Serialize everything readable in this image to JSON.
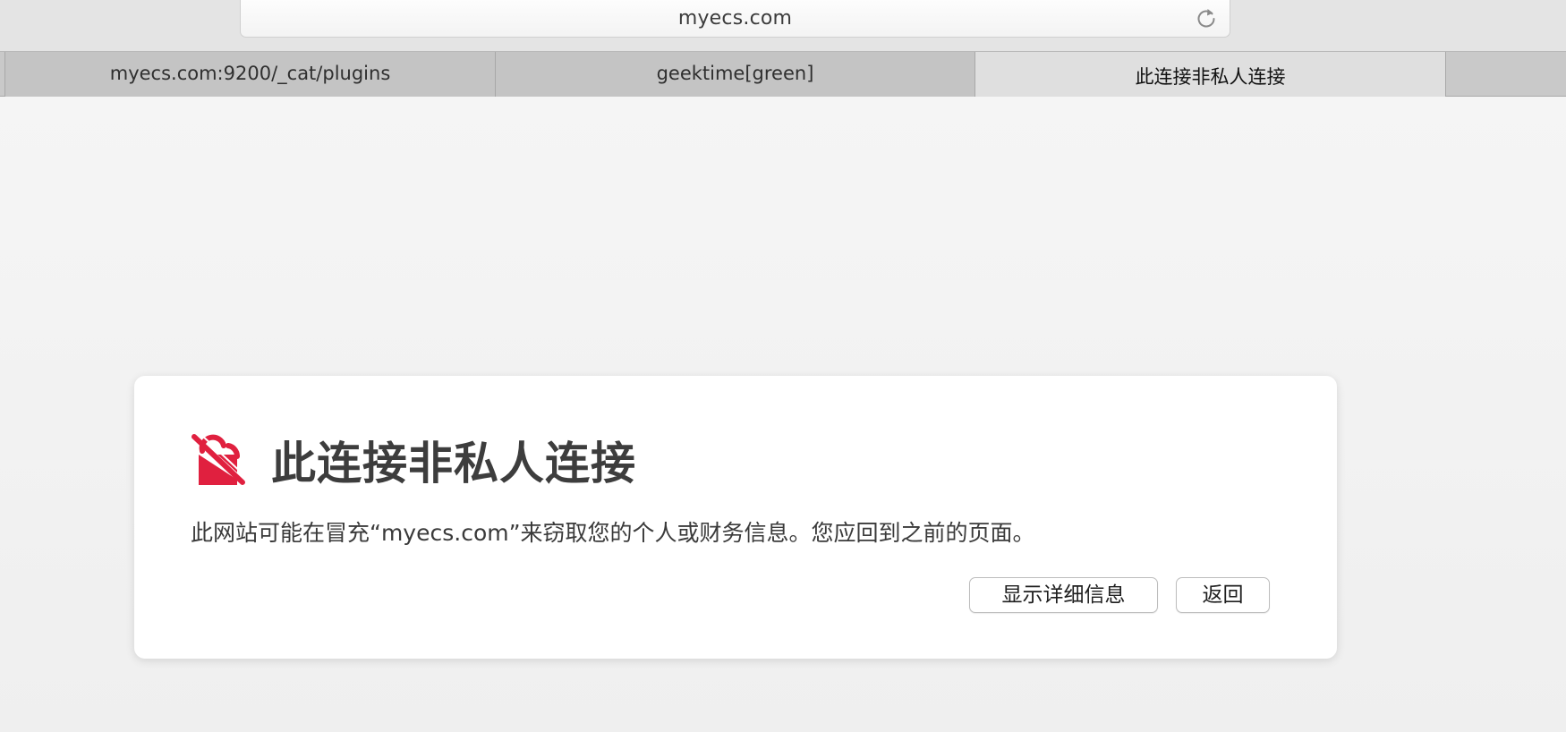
{
  "address_bar": {
    "url": "myecs.com"
  },
  "tabs": [
    {
      "label": "myecs.com:9200/_cat/plugins",
      "active": false
    },
    {
      "label": "geektime[green]",
      "active": false
    },
    {
      "label": "此连接非私人连接",
      "active": true
    }
  ],
  "warning": {
    "title": "此连接非私人连接",
    "message": "此网站可能在冒充“myecs.com”来窃取您的个人或财务信息。您应回到之前的页面。",
    "details_button": "显示详细信息",
    "back_button": "返回",
    "icon": "broken-lock-icon",
    "accent_color": "#e0203f"
  },
  "toolbar": {
    "reload_icon": "reload-icon"
  }
}
